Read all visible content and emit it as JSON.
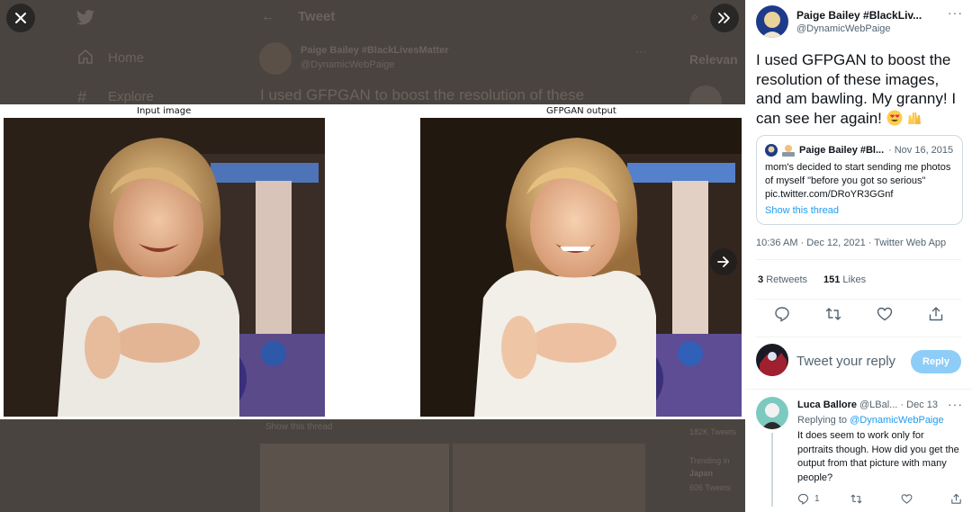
{
  "background": {
    "nav": {
      "home": "Home",
      "explore": "Explore"
    },
    "header": {
      "title": "Tweet"
    },
    "tweet": {
      "name": "Paige Bailey #BlackLivesMatter",
      "handle": "@DynamicWebPaige",
      "text": "I used GFPGAN to boost the resolution of these",
      "show_thread": "Show this thread"
    },
    "sidebar": {
      "relevant": "Relevan",
      "trend_count_a": "182K Tweets",
      "trend_context": "Trending in",
      "trend_name": "Japan",
      "trend_count_b": "606 Tweets"
    }
  },
  "media": {
    "input_caption": "Input image",
    "output_caption": "GFPGAN output"
  },
  "tweet": {
    "author_name": "Paige Bailey #BlackLiv...",
    "author_handle": "@DynamicWebPaige",
    "text": "I used GFPGAN to boost the resolution of these images, and am bawling. My granny! I can see her again!",
    "emojis": [
      "heart-eyes-emoji",
      "raised-hands-emoji"
    ],
    "quote": {
      "name": "Paige Bailey #Bl...",
      "date": "· Nov 16, 2015",
      "text": "mom's decided to start sending me photos of myself \"before you got so serious\" pic.twitter.com/DRoYR3GGnf",
      "show_thread": "Show this thread"
    },
    "timestamp": "10:36 AM · Dec 12, 2021 · Twitter Web App",
    "retweets_count": "3",
    "retweets_label": "Retweets",
    "likes_count": "151",
    "likes_label": "Likes"
  },
  "compose": {
    "placeholder": "Tweet your reply",
    "button": "Reply"
  },
  "reply": {
    "name": "Luca Ballore",
    "handle_date": "@LBal... · Dec 13",
    "replying_label": "Replying to",
    "replying_handle": "@DynamicWebPaige",
    "text": "It does seem to work only for portraits though. How did you get the output from that picture with many people?",
    "reply_count": "1"
  },
  "colors": {
    "accent": "#1d9bf0",
    "reply_button": "#8ecdf8",
    "muted_text": "#536471",
    "overlay": "#4a4440"
  }
}
